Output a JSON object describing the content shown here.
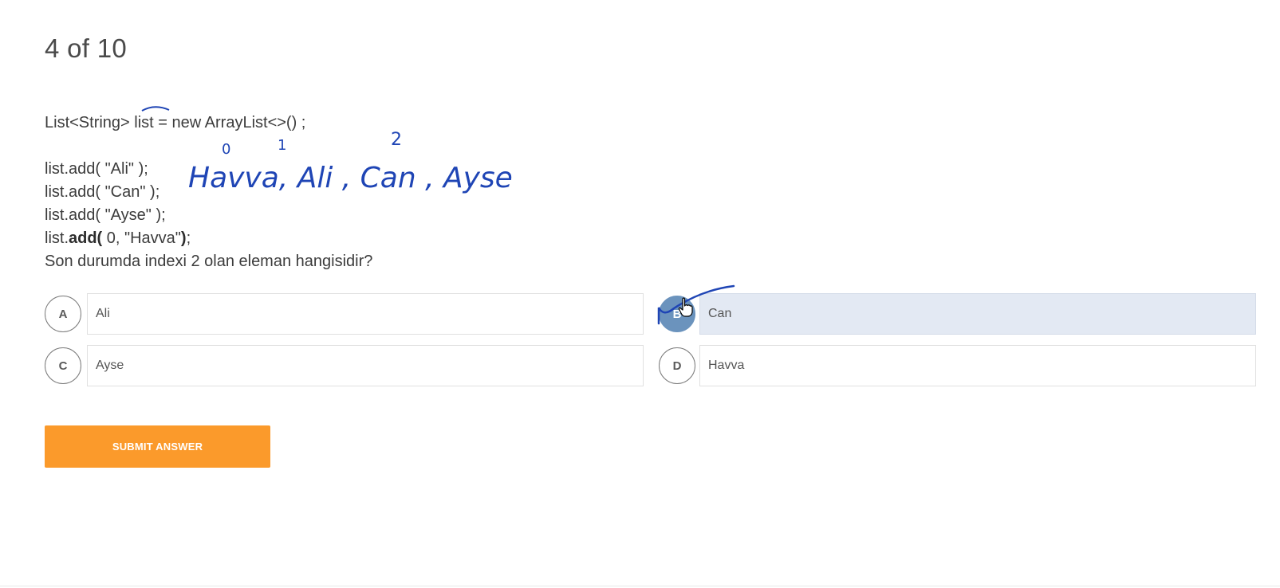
{
  "progress": {
    "label": "4 of 10"
  },
  "question": {
    "line1": "List<String> list = new ArrayList<>() ;",
    "line2": "list.add( \"Ali\" );",
    "line3": "list.add( \"Can\" );",
    "line4": "list.add( \"Ayse\" );",
    "line5_prefix": "list.",
    "line5_bold_a": "add(",
    "line5_middle": " 0, \"Havva\"",
    "line5_bold_b": ")",
    "line5_suffix": ";",
    "prompt": "Son durumda indexi 2 olan eleman hangisidir?"
  },
  "options": [
    {
      "letter": "A",
      "text": "Ali",
      "selected": false
    },
    {
      "letter": "B",
      "text": "Can",
      "selected": true
    },
    {
      "letter": "C",
      "text": "Ayse",
      "selected": false
    },
    {
      "letter": "D",
      "text": "Havva",
      "selected": false
    }
  ],
  "submit": {
    "label": "SUBMIT ANSWER"
  },
  "annotations": {
    "index0": "0",
    "index1": "1",
    "index2": "2",
    "handwriting": "Havva, Ali , Can , Ayse",
    "ink_color": "#1f45b5"
  },
  "colors": {
    "accent": "#fb9a2b",
    "selected_circle": "#6b93bd",
    "selected_box": "#e3e9f3"
  }
}
